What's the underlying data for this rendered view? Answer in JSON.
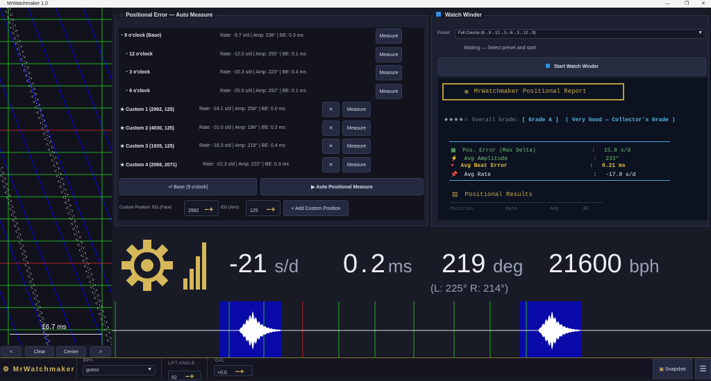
{
  "window": {
    "title": "MrWatchmaker 1.0"
  },
  "scope": {
    "scale_label": "16.7 ms",
    "buttons": [
      "<",
      "Clear",
      "Center",
      ">"
    ]
  },
  "positional": {
    "title": "Positional Error — Auto Measure",
    "positions": [
      {
        "label": "9 o'clock (Base)",
        "stats": "Rate: -9.7 s/d  |  Amp: 236°  |  BE: 0.3 ms",
        "measure": "Measure"
      },
      {
        "label": "12 o'clock",
        "stats": "Rate: -12.0 s/d  |  Amp: 255°  |  BE: 0.1 ms",
        "measure": "Measure"
      },
      {
        "label": "3 o'clock",
        "stats": "Rate: -20.3 s/d  |  Amp: 223°  |  BE: 0.4 ms",
        "measure": "Measure"
      },
      {
        "label": "6 o'clock",
        "stats": "Rate: -25.5 s/d  |  Amp: 252°  |  BE: 0.1 ms",
        "measure": "Measure"
      }
    ],
    "custom": [
      {
        "label": "★ Custom 1  (2992, 125)",
        "stats": "Rate: -24.1 s/d  |  Amp: 258°  |  BE: 0.0 ms",
        "remove": "✕",
        "measure": "Measure"
      },
      {
        "label": "★ Custom 2  (4030, 125)",
        "stats": "Rate: -10.0 s/d  |  Amp: 196°  |  BE: 0.2 ms",
        "remove": "✕",
        "measure": "Measure"
      },
      {
        "label": "★ Custom 3  (1935, 125)",
        "stats": "Rate: -18.3 s/d  |  Amp: 219°  |  BE: 0.4 ms",
        "remove": "✕",
        "measure": "Measure"
      },
      {
        "label": "★ Custom 4  (2068, 2071)",
        "stats": "Rate: -22.3 s/d  |  Amp: 222°  |  BE: 0.3 ms",
        "remove": "✕",
        "measure": "Measure"
      }
    ],
    "base_button": "⏎  Base (9 o'clock)",
    "auto_button": "▶  Auto Positional Measure",
    "custom_label": "Custom Position:",
    "id1_label": "ID1 (Face)",
    "id1_value": "2992",
    "id2_label": "ID2 (Arm)",
    "id2_value": "125",
    "add_button": "+  Add Custom Position"
  },
  "winder": {
    "title": "Watch Winder",
    "preset_label": "Preset",
    "preset_value": "Full Course (6→9→12→3→6→3→12→9)",
    "status": "Waiting — Select preset and start",
    "start_button": "Start Watch Winder",
    "report": {
      "title": "MrWatchmaker  Positional Report",
      "stars": "★★★★☆",
      "grade_label": "Overall Grade:",
      "grade": "[ Grade A ]",
      "grade_desc": "( Very Good — Collector's Grade )",
      "metrics": [
        {
          "label": "Pos. Error (Max Delta)",
          "value": "15.8 s/d",
          "color": "#6fbf73"
        },
        {
          "label": "Avg Amplitude",
          "value": "233°",
          "color": "#6fbf73"
        },
        {
          "label": "Avg Beat Error",
          "value": "0.21 ms",
          "color": "#e8c040"
        },
        {
          "label": "Avg Rate",
          "value": "-17.8 s/d",
          "color": "#e6e8ee"
        }
      ],
      "results_title": "Positional Results",
      "columns": [
        "Position",
        "Rate",
        "Amp",
        "BE"
      ]
    }
  },
  "readout": {
    "rate": "-21",
    "rate_unit": "s/d",
    "beat_error": "0.2",
    "beat_error_unit": "ms",
    "amplitude": "219",
    "amplitude_unit": "deg",
    "bph": "21600",
    "bph_unit": "bph",
    "amp_detail": "(L: 225°  R: 214°)"
  },
  "bottom": {
    "brand": "MrWatchmaker",
    "bph_label": "BPH",
    "bph_value": "guess",
    "lift_label": "LIFT ANGLE",
    "lift_value": "52",
    "cal_label": "CAL",
    "cal_value": "+0.0",
    "snapshot": "Snapshot"
  },
  "colors": {
    "accent": "#d6b85a",
    "trace_blue": "#0a0aa8",
    "grid_green": "#22b022",
    "grid_red": "#c02020"
  }
}
